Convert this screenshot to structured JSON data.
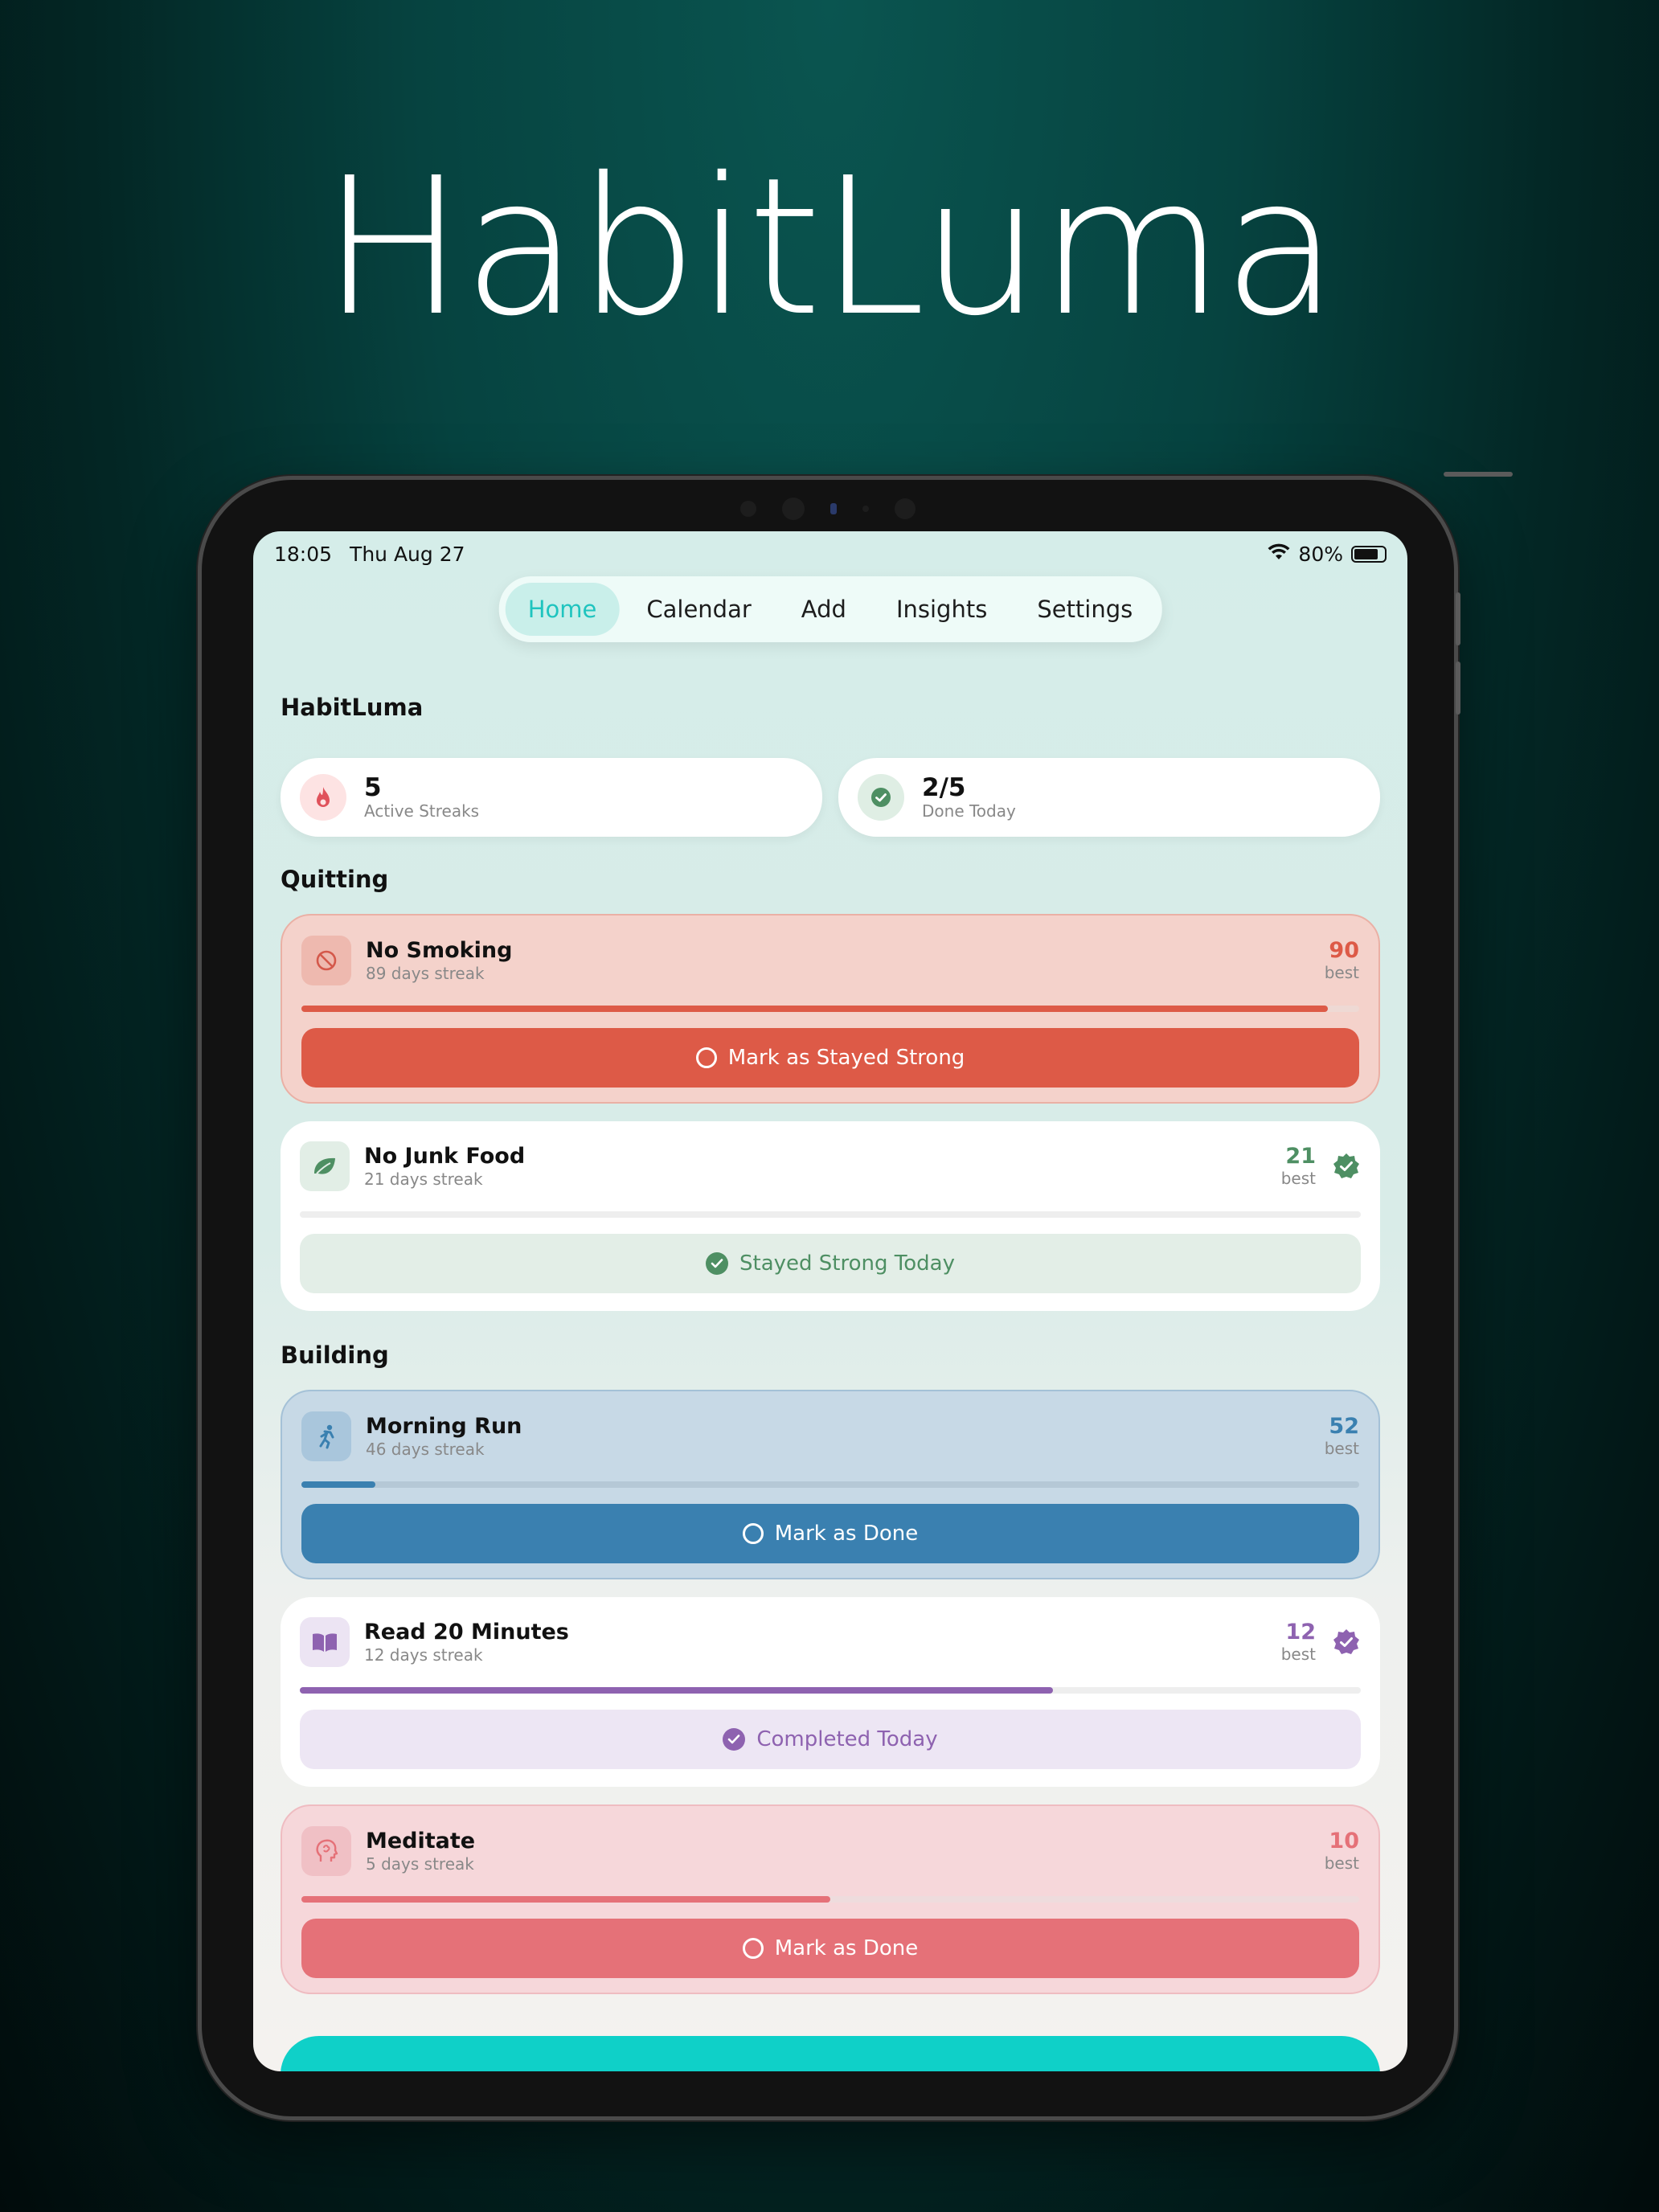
{
  "hero": {
    "title": "HabitLuma"
  },
  "status_bar": {
    "time": "18:05",
    "date": "Thu Aug 27",
    "battery": "80%"
  },
  "nav": {
    "tabs": [
      "Home",
      "Calendar",
      "Add",
      "Insights",
      "Settings"
    ],
    "active": "Home"
  },
  "app_title": "HabitLuma",
  "stats": [
    {
      "value": "5",
      "label": "Active Streaks",
      "icon": "flame-icon"
    },
    {
      "value": "2/5",
      "label": "Done Today",
      "icon": "check-circle-icon"
    }
  ],
  "sections": {
    "quitting": "Quitting",
    "building": "Building"
  },
  "habits": [
    {
      "name": "No Smoking",
      "streak": "89 days streak",
      "best": "90",
      "best_label": "best",
      "progress": 0.97,
      "action": "Mark as Stayed Strong",
      "done": false,
      "icon": "no-smoking-icon",
      "accent": "#dd5a47"
    },
    {
      "name": "No Junk Food",
      "streak": "21 days streak",
      "best": "21",
      "best_label": "best",
      "progress": 0.0,
      "action": "Stayed Strong Today",
      "done": true,
      "icon": "leaf-icon",
      "accent": "#4e8f63"
    },
    {
      "name": "Morning Run",
      "streak": "46 days streak",
      "best": "52",
      "best_label": "best",
      "progress": 0.07,
      "action": "Mark as Done",
      "done": false,
      "icon": "runner-icon",
      "accent": "#3a80b0"
    },
    {
      "name": "Read 20 Minutes",
      "streak": "12 days streak",
      "best": "12",
      "best_label": "best",
      "progress": 0.71,
      "action": "Completed Today",
      "done": true,
      "icon": "book-icon",
      "accent": "#8e62b0"
    },
    {
      "name": "Meditate",
      "streak": "5 days streak",
      "best": "10",
      "best_label": "best",
      "progress": 0.5,
      "action": "Mark as Done",
      "done": false,
      "icon": "head-icon",
      "accent": "#e57178"
    }
  ]
}
